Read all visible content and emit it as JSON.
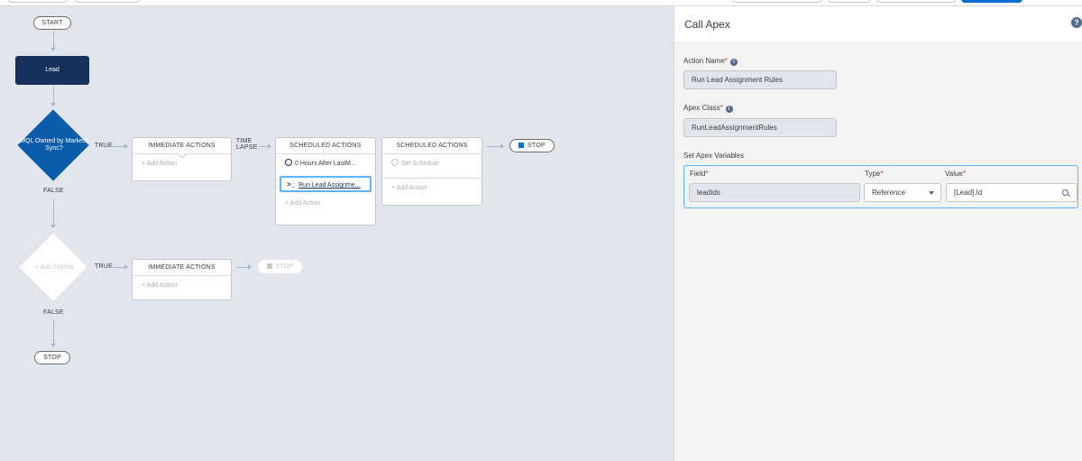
{
  "canvas": {
    "start_label": "START",
    "lead_label": "Lead",
    "criteria1": {
      "label": "MQL Owned by Marketo Sync?",
      "true_label": "TRUE",
      "false_label": "FALSE"
    },
    "criteria2": {
      "label": "+ Add Criteria",
      "true_label": "TRUE",
      "false_label": "FALSE"
    },
    "time_lapse_label": "TIME LAPSE",
    "immediate1": {
      "title": "IMMEDIATE ACTIONS",
      "add_action": "+ Add Action"
    },
    "scheduled1": {
      "title": "SCHEDULED ACTIONS",
      "schedule": "0 Hours After LastM...",
      "action": "Run Lead Assignme...",
      "add_action": "+ Add Action"
    },
    "scheduled2": {
      "title": "SCHEDULED ACTIONS",
      "schedule": "Set Schedule",
      "add_action": "+ Add Action"
    },
    "immediate2": {
      "title": "IMMEDIATE ACTIONS",
      "add_action": "+ Add Action"
    },
    "stop1": "STOP",
    "stop2": "STOP",
    "stop3": "STOP"
  },
  "panel": {
    "title": "Call Apex",
    "help_icon": "question-icon",
    "action_name_label": "Action Name",
    "action_name_value": "Run Lead Assignment Rules",
    "apex_class_label": "Apex Class",
    "apex_class_value": "RunLeadAssignmentRules",
    "set_vars_label": "Set Apex Variables",
    "columns": {
      "field": "Field",
      "type": "Type",
      "value": "Value"
    },
    "row": {
      "field": "leadIds",
      "type": "Reference",
      "value": "[Lead].Id"
    }
  },
  "colors": {
    "brand": "#0070d2",
    "node_dark": "#16325c",
    "diamond": "#0b5cab",
    "canvas_bg": "#e1e5ee",
    "selected_border": "#5eb4ff",
    "required": "#c23934"
  }
}
